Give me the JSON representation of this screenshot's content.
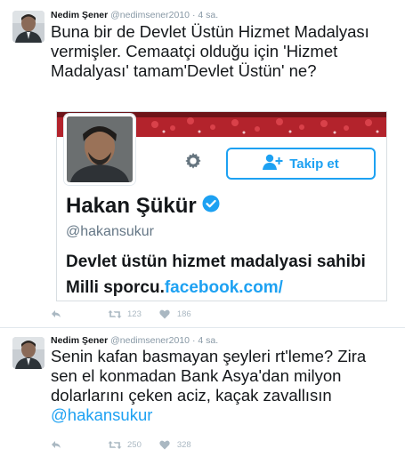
{
  "colors": {
    "accent": "#1da1f2",
    "muted": "#8899a6",
    "icon": "#aab8c2",
    "text": "#14171a"
  },
  "tweets": [
    {
      "name": "Nedim Şener",
      "handle": "@nedimsener2010",
      "dot": "·",
      "time": "4 sa.",
      "text": "Buna bir de Devlet Üstün Hizmet Madalyası vermişler. Cemaatçi olduğu için 'Hizmet Madalyası' tamam'Devlet Üstün' ne?",
      "retweets": "123",
      "likes": "186",
      "icons": {
        "reply": "reply-icon",
        "retweet": "retweet-icon",
        "like": "heart-icon",
        "avatar": "avatar"
      }
    },
    {
      "name": "Nedim Şener",
      "handle": "@nedimsener2010",
      "dot": "·",
      "time": "4 sa.",
      "text_before": "Senin kafan basmayan şeyleri rt'leme? Zira sen el konmadan Bank Asya'dan milyon dolarlarını çeken aciz, kaçak zavallısın ",
      "mention": "@hakansukur",
      "retweets": "250",
      "likes": "328",
      "icons": {
        "reply": "reply-icon",
        "retweet": "retweet-icon",
        "like": "heart-icon",
        "avatar": "avatar"
      }
    }
  ],
  "embed": {
    "name": "Hakan Şükür",
    "handle": "@hakansukur",
    "follow_label": "Takip et",
    "text": "Devlet üstün hizmet madalyasi sahibi Milli sporcu.",
    "link": "facebook.com/",
    "icons": {
      "gear": "gear-icon",
      "follow": "add-user-icon",
      "verified": "verified-badge-icon"
    }
  }
}
